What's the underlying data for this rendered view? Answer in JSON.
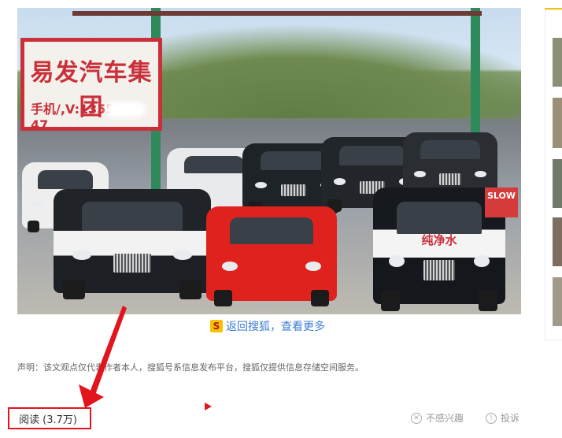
{
  "photo": {
    "sign_title": "易发汽车集团",
    "sign_phone": "手机/,V:1355",
    "sign_phone_tail": "47",
    "car_label": "纯净水",
    "slow_sign": "SLOW"
  },
  "article": {
    "back_link_icon": "S",
    "back_link": "返回搜狐，查看更多",
    "disclaimer": "声明：该文观点仅代表作者本人，搜狐号系信息发布平台，搜狐仅提供信息存储空间服务。"
  },
  "footer": {
    "read_count": "阅读 (3.7万)",
    "not_interested": "不感兴趣",
    "report": "投诉"
  },
  "colors": {
    "accent_red": "#e2141c",
    "link_blue": "#3b7cd6",
    "sohu_yellow": "#f5c400"
  }
}
